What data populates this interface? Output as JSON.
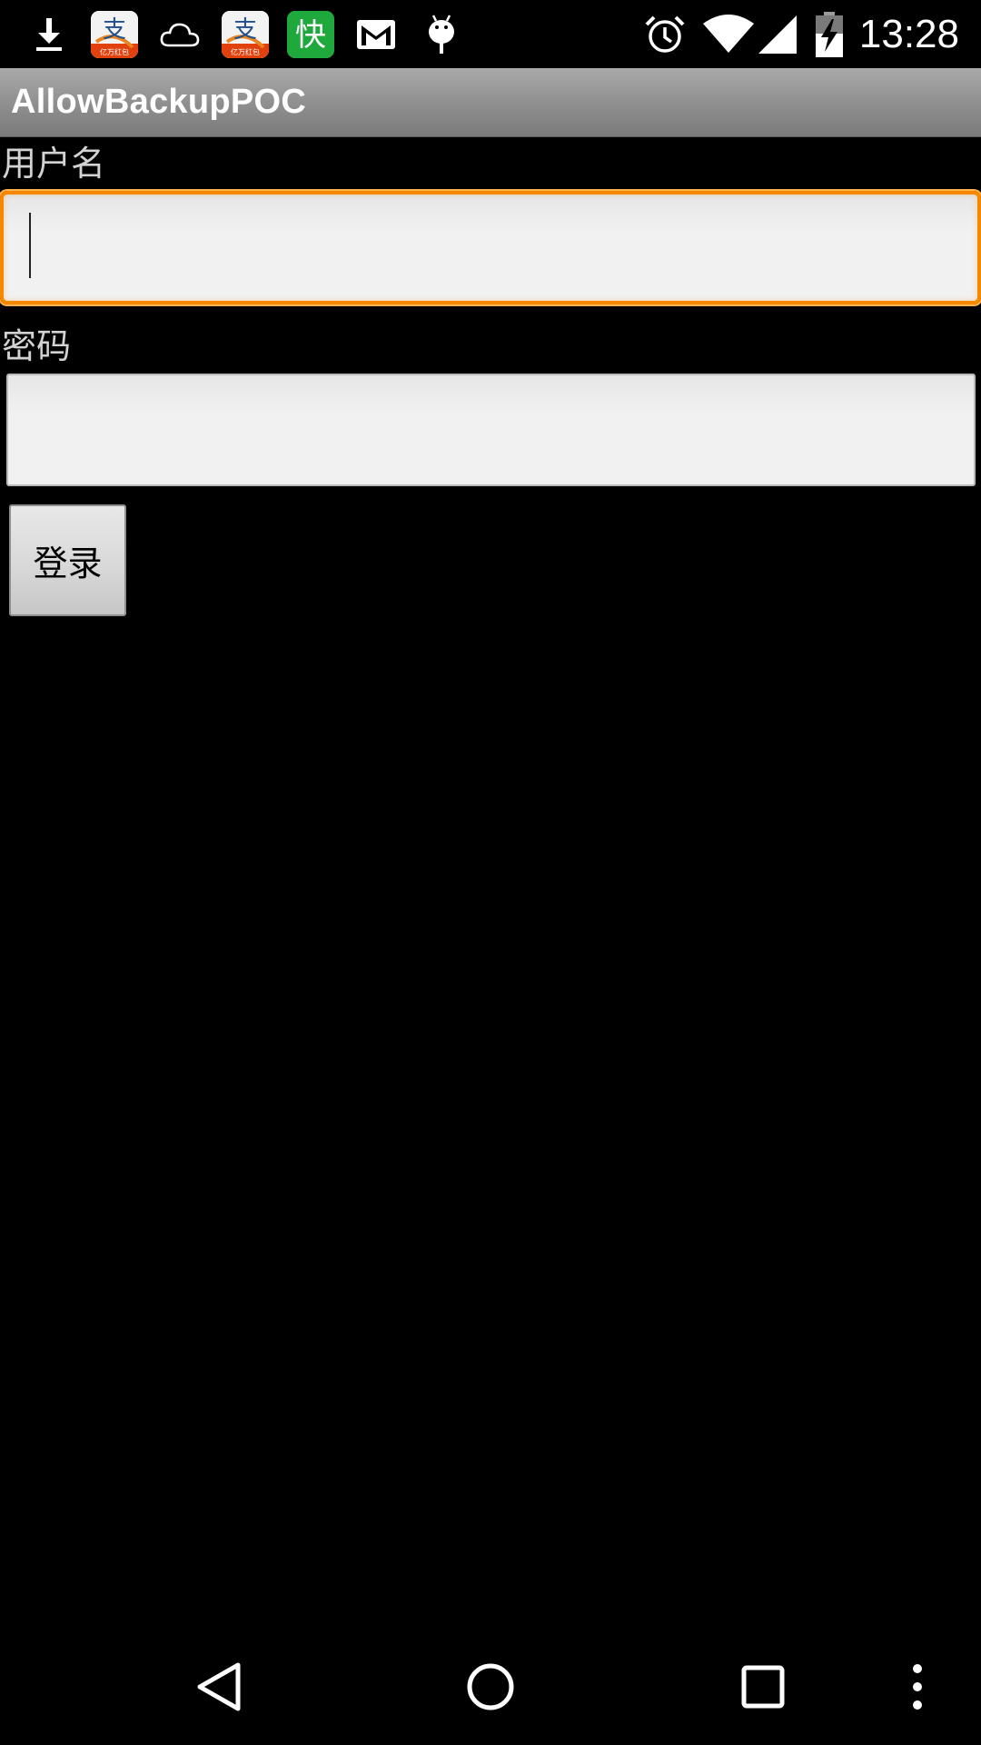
{
  "status_bar": {
    "time": "13:28",
    "notification_icons": [
      "download-icon",
      "alipay-app-icon",
      "cloud-icon",
      "alipay-app-icon",
      "kuai-app-icon",
      "gmail-icon",
      "android-debug-icon"
    ],
    "alipay_glyph": "支",
    "alipay_caption": "亿万红包",
    "kuai_glyph": "快",
    "system_icons": [
      "alarm-icon",
      "wifi-icon",
      "cellular-signal-icon",
      "battery-charging-icon"
    ]
  },
  "action_bar": {
    "title": "AllowBackupPOC"
  },
  "form": {
    "username_label": "用户名",
    "username_value": "",
    "password_label": "密码",
    "password_value": "",
    "login_button_label": "登录"
  },
  "nav_bar": {
    "buttons": [
      "back-icon",
      "home-icon",
      "recents-icon",
      "overflow-menu-icon"
    ]
  },
  "colors": {
    "background": "#000000",
    "action_bar": "#8e8e8e",
    "focus_border": "#f68800",
    "label_text": "#d2d2d2"
  }
}
